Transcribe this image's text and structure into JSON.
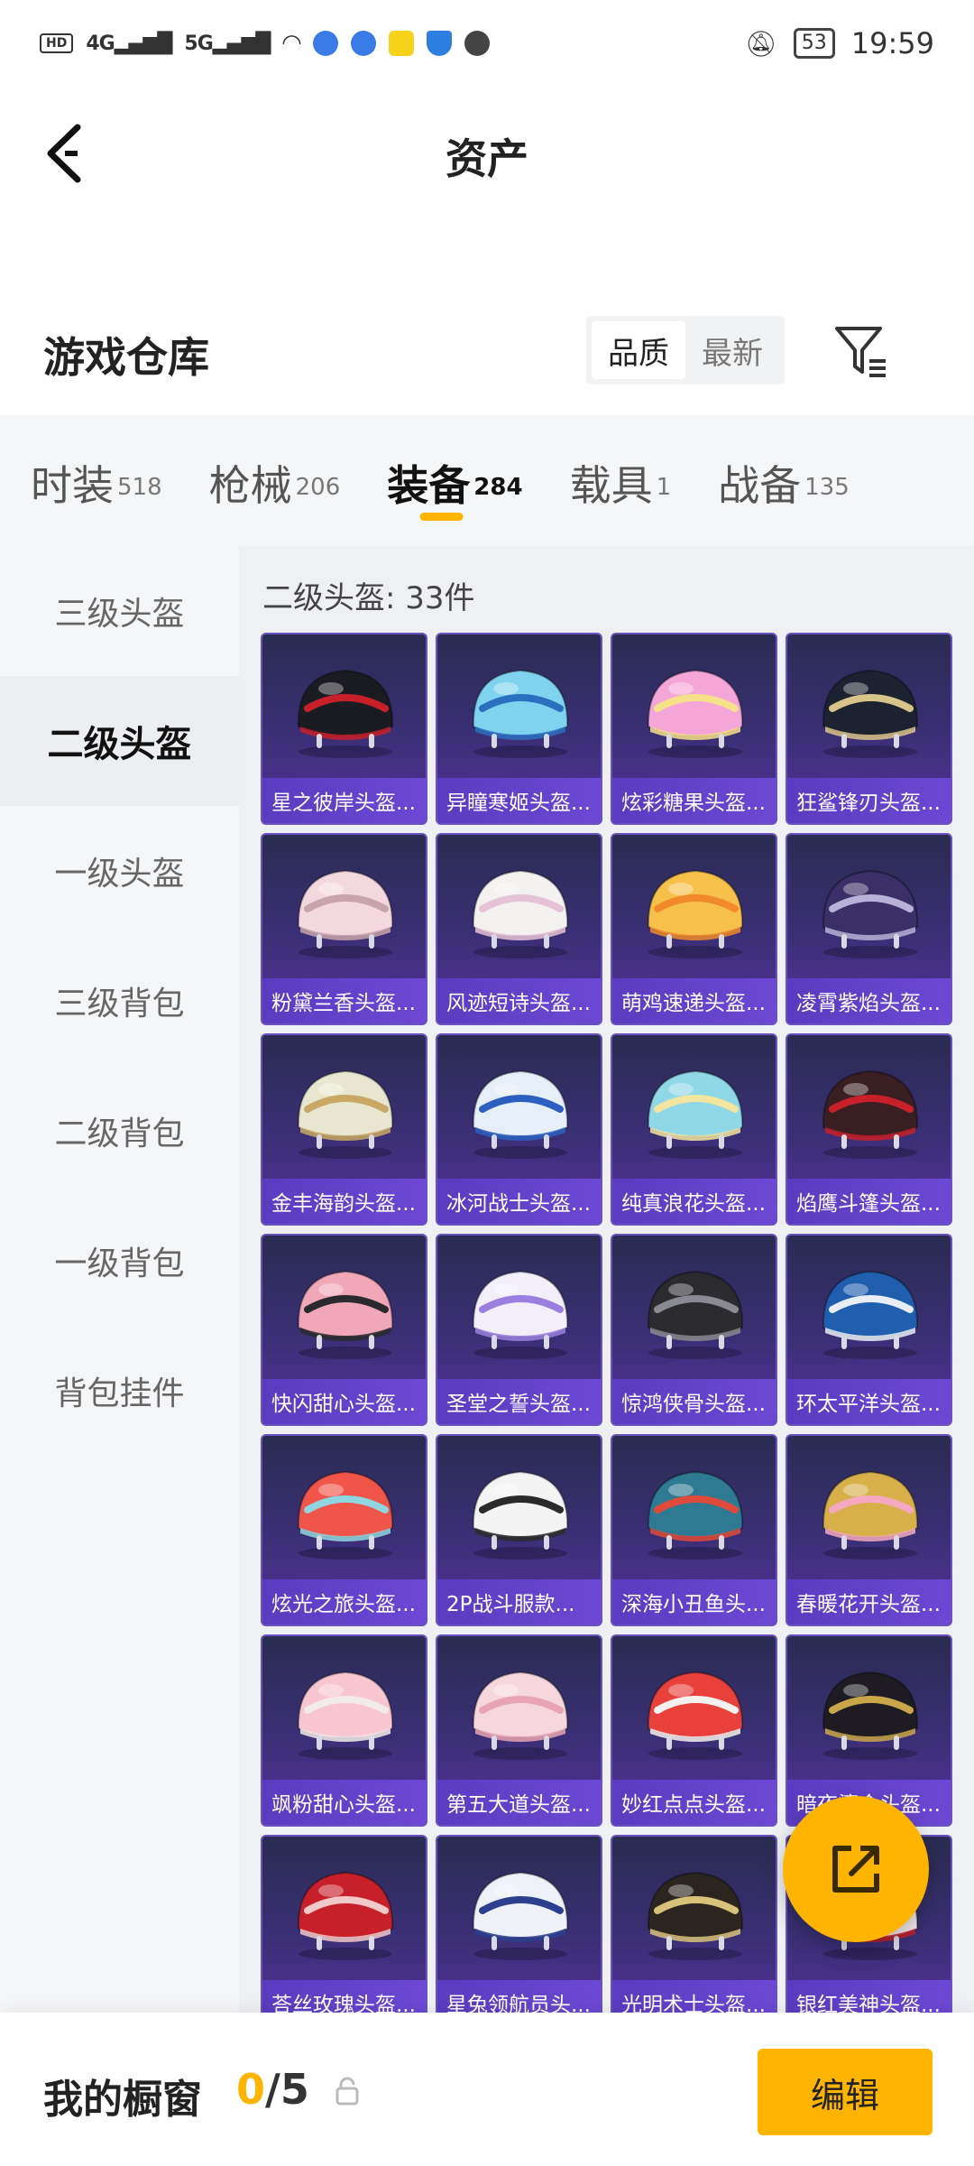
{
  "status_bar": {
    "left": [
      "HD",
      "4G",
      "5G"
    ],
    "time": "19:59",
    "battery": "53"
  },
  "header": {
    "title": "资产"
  },
  "warehouse": {
    "title": "游戏仓库",
    "sort_options": [
      "品质",
      "最新"
    ],
    "active_sort": "品质"
  },
  "categories": [
    {
      "name": "时装",
      "count": "518"
    },
    {
      "name": "枪械",
      "count": "206"
    },
    {
      "name": "装备",
      "count": "284",
      "active": true
    },
    {
      "name": "载具",
      "count": "1"
    },
    {
      "name": "战备",
      "count": "135"
    }
  ],
  "sidebar": {
    "items": [
      "三级头盔",
      "二级头盔",
      "一级头盔",
      "三级背包",
      "二级背包",
      "一级背包",
      "背包挂件"
    ],
    "active_index": 1
  },
  "content": {
    "count_label": "二级头盔: 33件",
    "items": [
      {
        "name": "星之彼岸头盔...",
        "colors": [
          "#1b1b22",
          "#c8202a"
        ]
      },
      {
        "name": "异瞳寒姬头盔...",
        "colors": [
          "#7fd3ef",
          "#2b6fbf"
        ]
      },
      {
        "name": "炫彩糖果头盔...",
        "colors": [
          "#f4a6d8",
          "#f6e08a"
        ]
      },
      {
        "name": "狂鲨锋刃头盔...",
        "colors": [
          "#1d2230",
          "#d7c48a"
        ]
      },
      {
        "name": "粉黛兰香头盔...",
        "colors": [
          "#f3d9df",
          "#c9a3ad"
        ]
      },
      {
        "name": "风迹短诗头盔...",
        "colors": [
          "#f4f2f0",
          "#e6c2d6"
        ]
      },
      {
        "name": "萌鸡速递头盔...",
        "colors": [
          "#f6c04a",
          "#f08a2b"
        ]
      },
      {
        "name": "凌霄紫焰头盔...",
        "colors": [
          "#3a2f66",
          "#b9b2d8"
        ]
      },
      {
        "name": "金丰海韵头盔...",
        "colors": [
          "#e8e6cf",
          "#c9a866"
        ]
      },
      {
        "name": "冰河战士头盔...",
        "colors": [
          "#e6eef8",
          "#2c5fbf"
        ]
      },
      {
        "name": "纯真浪花头盔...",
        "colors": [
          "#8fd8e8",
          "#f3e4a0"
        ]
      },
      {
        "name": "焰鹰斗篷头盔...",
        "colors": [
          "#3a1f22",
          "#c8202a"
        ]
      },
      {
        "name": "快闪甜心头盔...",
        "colors": [
          "#f0a7b8",
          "#2a2a2e"
        ]
      },
      {
        "name": "圣堂之誓头盔...",
        "colors": [
          "#f2eefa",
          "#9a7fe0"
        ]
      },
      {
        "name": "惊鸿侠骨头盔...",
        "colors": [
          "#2b2b30",
          "#8a8a92"
        ]
      },
      {
        "name": "环太平洋头盔...",
        "colors": [
          "#1f5fae",
          "#e9eef6"
        ]
      },
      {
        "name": "炫光之旅头盔...",
        "colors": [
          "#f0554a",
          "#8fd6e0"
        ]
      },
      {
        "name": "2P战斗服款...",
        "colors": [
          "#f4f4f4",
          "#2b2b2b"
        ]
      },
      {
        "name": "深海小丑鱼头...",
        "colors": [
          "#2e7a92",
          "#e04a3a"
        ]
      },
      {
        "name": "春暖花开头盔...",
        "colors": [
          "#d7b04a",
          "#f4a9c0"
        ]
      },
      {
        "name": "飒粉甜心头盔...",
        "colors": [
          "#f7c6d0",
          "#f3eaea"
        ]
      },
      {
        "name": "第五大道头盔...",
        "colors": [
          "#f6d7dd",
          "#e7a5b4"
        ]
      },
      {
        "name": "妙红点点头盔...",
        "colors": [
          "#e8413c",
          "#f6f0ef"
        ]
      },
      {
        "name": "暗夜鎏金头盔...",
        "colors": [
          "#1e1c22",
          "#c9a64a"
        ]
      },
      {
        "name": "荅丝玫瑰头盔...",
        "colors": [
          "#c8202a",
          "#f2c9c9"
        ]
      },
      {
        "name": "星兔领航员头...",
        "colors": [
          "#eef1f8",
          "#2d3f8f"
        ]
      },
      {
        "name": "光明术士头盔...",
        "colors": [
          "#2b2520",
          "#d8c27a"
        ]
      },
      {
        "name": "银红美神头盔...",
        "colors": [
          "#f3e8ea",
          "#c8202a"
        ]
      }
    ]
  },
  "fab": {
    "icon": "share-export-icon"
  },
  "bottom_bar": {
    "title": "我的橱窗",
    "count_current": "0",
    "count_sep": "/",
    "count_total": "5",
    "edit_label": "编辑"
  },
  "colors": {
    "accent": "#ffb400",
    "card_bg": "#3b2f76",
    "card_label": "#6245cc"
  }
}
